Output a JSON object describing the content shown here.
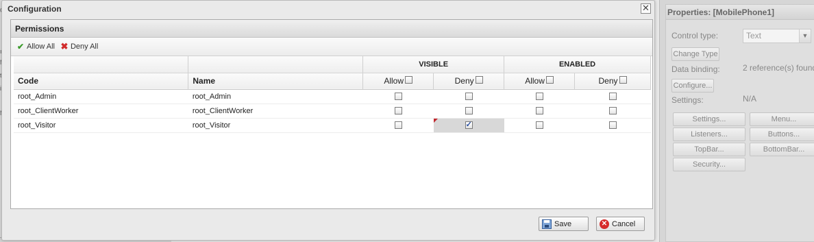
{
  "modal": {
    "title": "Configuration",
    "close_glyph": "✕",
    "panel_title": "Permissions",
    "toolbar": {
      "allow_all": "Allow All",
      "deny_all": "Deny All",
      "allow_icon": "check-icon",
      "deny_icon": "x-icon"
    },
    "grid": {
      "group_visible": "VISIBLE",
      "group_enabled": "ENABLED",
      "col_code": "Code",
      "col_name": "Name",
      "sub_allow": "Allow",
      "sub_deny": "Deny",
      "rows": [
        {
          "code": "root_Admin",
          "name": "root_Admin"
        },
        {
          "code": "root_ClientWorker",
          "name": "root_ClientWorker"
        },
        {
          "code": "root_Visitor",
          "name": "root_Visitor"
        }
      ]
    },
    "save_label": "Save",
    "cancel_label": "Cancel"
  },
  "properties": {
    "title": "Properties: [MobilePhone1]",
    "control_type_label": "Control type:",
    "control_type_value": "Text",
    "change_type_button": "Change Type",
    "data_binding_label": "Data binding:",
    "data_binding_value": "2 reference(s) found",
    "configure_button": "Configure...",
    "settings_label": "Settings:",
    "settings_value": "N/A",
    "buttons": {
      "settings": "Settings...",
      "menu": "Menu...",
      "listeners": "Listeners...",
      "buttons": "Buttons...",
      "topbar": "TopBar...",
      "bottombar": "BottomBar...",
      "security": "Security..."
    }
  },
  "background_app": {
    "fragments": [
      "G",
      "ıg",
      "M",
      "ts",
      "io",
      "M"
    ]
  }
}
